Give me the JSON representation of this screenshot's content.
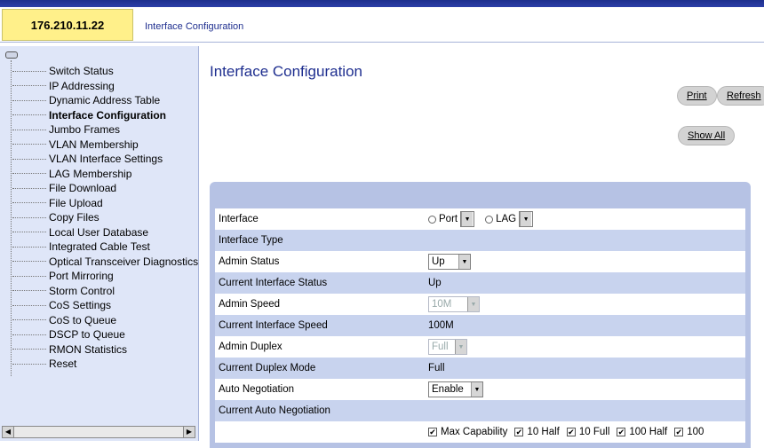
{
  "header": {
    "ip_address": "176.210.11.22",
    "breadcrumb": "Interface Configuration"
  },
  "sidebar": {
    "items": [
      {
        "label": "Switch Status"
      },
      {
        "label": "IP Addressing"
      },
      {
        "label": "Dynamic Address Table"
      },
      {
        "label": "Interface Configuration",
        "active": true
      },
      {
        "label": "Jumbo Frames"
      },
      {
        "label": "VLAN Membership"
      },
      {
        "label": "VLAN Interface Settings"
      },
      {
        "label": "LAG Membership"
      },
      {
        "label": "File Download"
      },
      {
        "label": "File Upload"
      },
      {
        "label": "Copy Files"
      },
      {
        "label": "Local User Database"
      },
      {
        "label": "Integrated Cable Test"
      },
      {
        "label": "Optical Transceiver Diagnostics"
      },
      {
        "label": "Port Mirroring"
      },
      {
        "label": "Storm Control"
      },
      {
        "label": "CoS Settings"
      },
      {
        "label": "CoS to Queue"
      },
      {
        "label": "DSCP to Queue"
      },
      {
        "label": "RMON Statistics"
      },
      {
        "label": "Reset"
      }
    ]
  },
  "main": {
    "title": "Interface Configuration",
    "buttons": {
      "print": "Print",
      "refresh": "Refresh",
      "show_all": "Show All"
    }
  },
  "form": {
    "interface": {
      "label": "Interface",
      "port_label": "Port",
      "lag_label": "LAG"
    },
    "interface_type": {
      "label": "Interface Type"
    },
    "admin_status": {
      "label": "Admin Status",
      "value": "Up"
    },
    "current_status": {
      "label": "Current Interface Status",
      "value": "Up"
    },
    "admin_speed": {
      "label": "Admin Speed",
      "value": "10M"
    },
    "current_speed": {
      "label": "Current Interface Speed",
      "value": "100M"
    },
    "admin_duplex": {
      "label": "Admin Duplex",
      "value": "Full"
    },
    "current_duplex": {
      "label": "Current Duplex Mode",
      "value": "Full"
    },
    "auto_negotiation": {
      "label": "Auto Negotiation",
      "value": "Enable"
    },
    "current_auto_negotiation": {
      "label": "Current Auto Negotiation"
    },
    "capabilities": [
      "Max Capability",
      "10 Half",
      "10 Full",
      "100 Half",
      "100"
    ]
  }
}
